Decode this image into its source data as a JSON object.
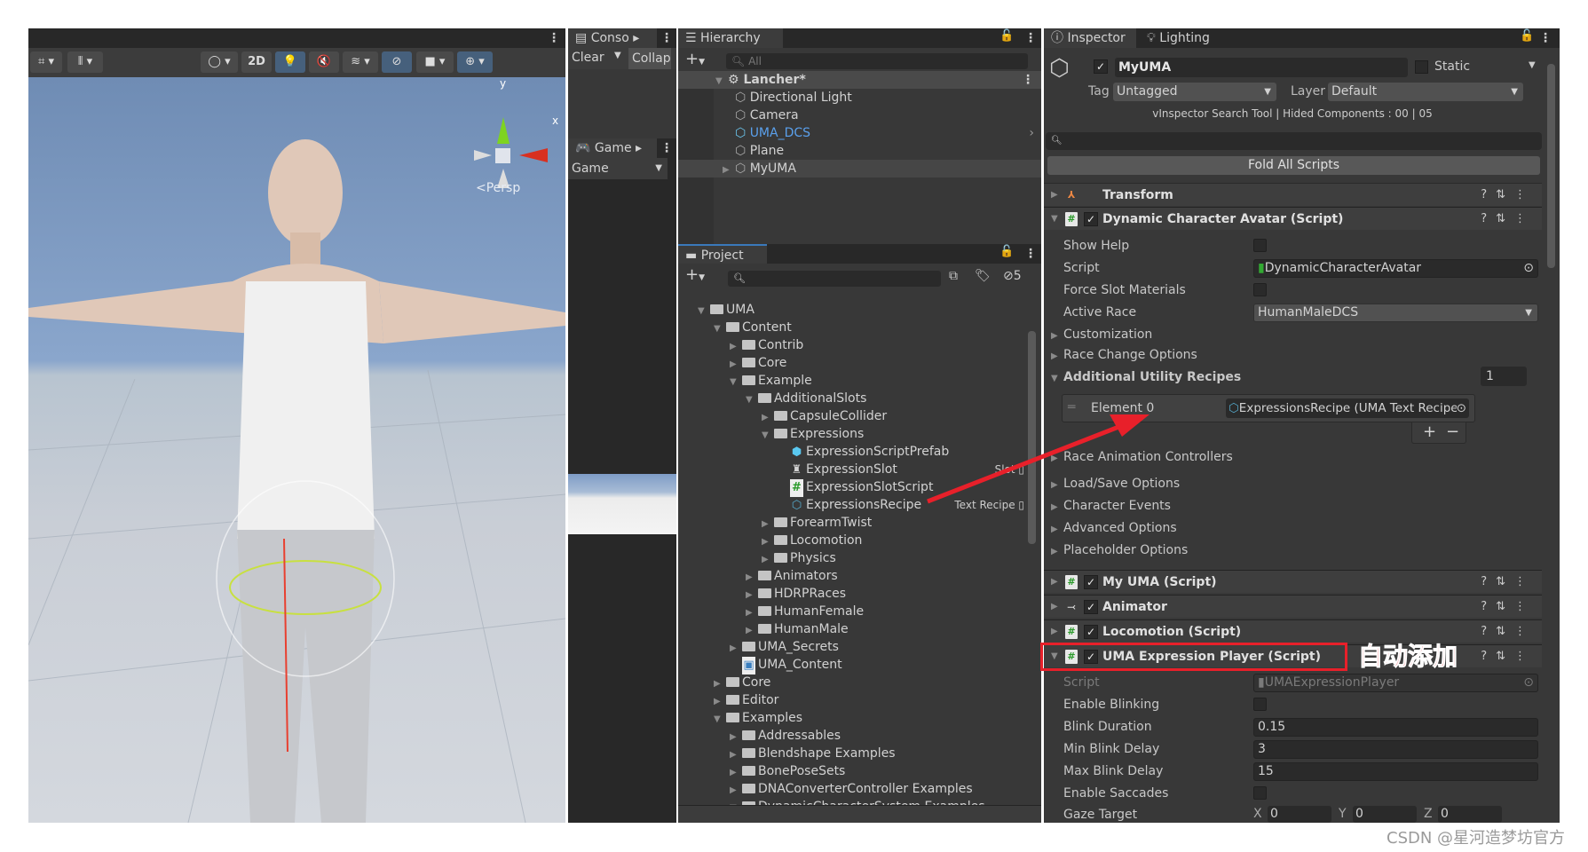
{
  "scene": {
    "toolbar": {
      "btn_2d": "2D"
    },
    "gizmo": {
      "y_label": "y",
      "x_label": "x",
      "persp_label": "Persp"
    }
  },
  "console": {
    "tab": "Conso",
    "clear": "Clear",
    "collapse": "Collap"
  },
  "game": {
    "tab": "Game",
    "display": "Game"
  },
  "hierarchy": {
    "tab": "Hierarchy",
    "search_placeholder": "All",
    "scene_name": "Lancher*",
    "items": [
      {
        "label": "Directional Light",
        "color": "#d2d2d2"
      },
      {
        "label": "Camera",
        "color": "#d2d2d2"
      },
      {
        "label": "UMA_DCS",
        "color": "#5aa0ec"
      },
      {
        "label": "Plane",
        "color": "#d2d2d2"
      },
      {
        "label": "MyUMA",
        "color": "#d2d2d2"
      }
    ]
  },
  "project": {
    "tab": "Project",
    "hidden_count": "5",
    "items": [
      {
        "label": "UMA",
        "level": 0,
        "kind": "open"
      },
      {
        "label": "Content",
        "level": 1,
        "kind": "open"
      },
      {
        "label": "Contrib",
        "level": 2,
        "kind": "closed"
      },
      {
        "label": "Core",
        "level": 2,
        "kind": "closed"
      },
      {
        "label": "Example",
        "level": 2,
        "kind": "open"
      },
      {
        "label": "AdditionalSlots",
        "level": 3,
        "kind": "open"
      },
      {
        "label": "CapsuleCollider",
        "level": 4,
        "kind": "closed"
      },
      {
        "label": "Expressions",
        "level": 4,
        "kind": "open"
      },
      {
        "label": "ExpressionScriptPrefab",
        "level": 5,
        "kind": "prefab"
      },
      {
        "label": "ExpressionSlot",
        "level": 5,
        "kind": "slot",
        "type": "Slot"
      },
      {
        "label": "ExpressionSlotScript",
        "level": 5,
        "kind": "script"
      },
      {
        "label": "ExpressionsRecipe",
        "level": 5,
        "kind": "recipe",
        "type": "Text Recipe"
      },
      {
        "label": "ForearmTwist",
        "level": 4,
        "kind": "closed"
      },
      {
        "label": "Locomotion",
        "level": 4,
        "kind": "closed"
      },
      {
        "label": "Physics",
        "level": 4,
        "kind": "closed"
      },
      {
        "label": "Animators",
        "level": 3,
        "kind": "closed"
      },
      {
        "label": "HDRPRaces",
        "level": 3,
        "kind": "closed"
      },
      {
        "label": "HumanFemale",
        "level": 3,
        "kind": "closed"
      },
      {
        "label": "HumanMale",
        "level": 3,
        "kind": "closed"
      },
      {
        "label": "UMA_Secrets",
        "level": 2,
        "kind": "closed"
      },
      {
        "label": "UMA_Content",
        "level": 2,
        "kind": "asset"
      },
      {
        "label": "Core",
        "level": 1,
        "kind": "closed"
      },
      {
        "label": "Editor",
        "level": 1,
        "kind": "closed"
      },
      {
        "label": "Examples",
        "level": 1,
        "kind": "open"
      },
      {
        "label": "Addressables",
        "level": 2,
        "kind": "closed"
      },
      {
        "label": "Blendshape Examples",
        "level": 2,
        "kind": "closed"
      },
      {
        "label": "BonePoseSets",
        "level": 2,
        "kind": "closed"
      },
      {
        "label": "DNAConverterController Examples",
        "level": 2,
        "kind": "closed"
      },
      {
        "label": "DynamicCharacterSystem Examples",
        "level": 2,
        "kind": "open"
      }
    ]
  },
  "inspector": {
    "tab": "Inspector",
    "lighting_tab": "Lighting",
    "object_name": "MyUMA",
    "static_label": "Static",
    "tag_label": "Tag",
    "tag_value": "Untagged",
    "layer_label": "Layer",
    "layer_value": "Default",
    "vinspector_info": "vInspector Search Tool | Hided Components : 00 | 05",
    "fold_all": "Fold All Scripts",
    "transform": "Transform",
    "dca": {
      "title": "Dynamic Character Avatar (Script)",
      "show_help": "Show Help",
      "script_label": "Script",
      "script_value": "DynamicCharacterAvatar",
      "force_slot": "Force Slot Materials",
      "active_race_label": "Active Race",
      "active_race_value": "HumanMaleDCS",
      "customization": "Customization",
      "race_change": "Race Change Options",
      "aur_label": "Additional Utility Recipes",
      "aur_count": "1",
      "element0_label": "Element 0",
      "element0_value": "ExpressionsRecipe (UMA Text Recipe)",
      "add": "+",
      "remove": "−",
      "race_anim": "Race Animation Controllers",
      "load_save": "Load/Save Options",
      "char_events": "Character Events",
      "advanced": "Advanced Options",
      "placeholder": "Placeholder Options"
    },
    "my_uma": "My UMA (Script)",
    "animator": "Animator",
    "locomotion": "Locomotion (Script)",
    "expr": {
      "title": "UMA Expression Player (Script)",
      "annotation": "自动添加",
      "script_label": "Script",
      "script_value": "UMAExpressionPlayer",
      "enable_blinking": "Enable Blinking",
      "blink_duration_label": "Blink Duration",
      "blink_duration": "0.15",
      "min_blink_label": "Min Blink Delay",
      "min_blink": "3",
      "max_blink_label": "Max Blink Delay",
      "max_blink": "15",
      "saccades": "Enable Saccades",
      "gaze_label": "Gaze Target",
      "gaze_x_label": "X",
      "gaze_x": "0",
      "gaze_y_label": "Y",
      "gaze_y": "0",
      "gaze_z_label": "Z",
      "gaze_z": "0"
    }
  },
  "watermark": "CSDN @星河造梦坊官方",
  "colors": {
    "highlight": "#e8202a",
    "panel": "#383838",
    "accent_blue": "#46607c"
  }
}
